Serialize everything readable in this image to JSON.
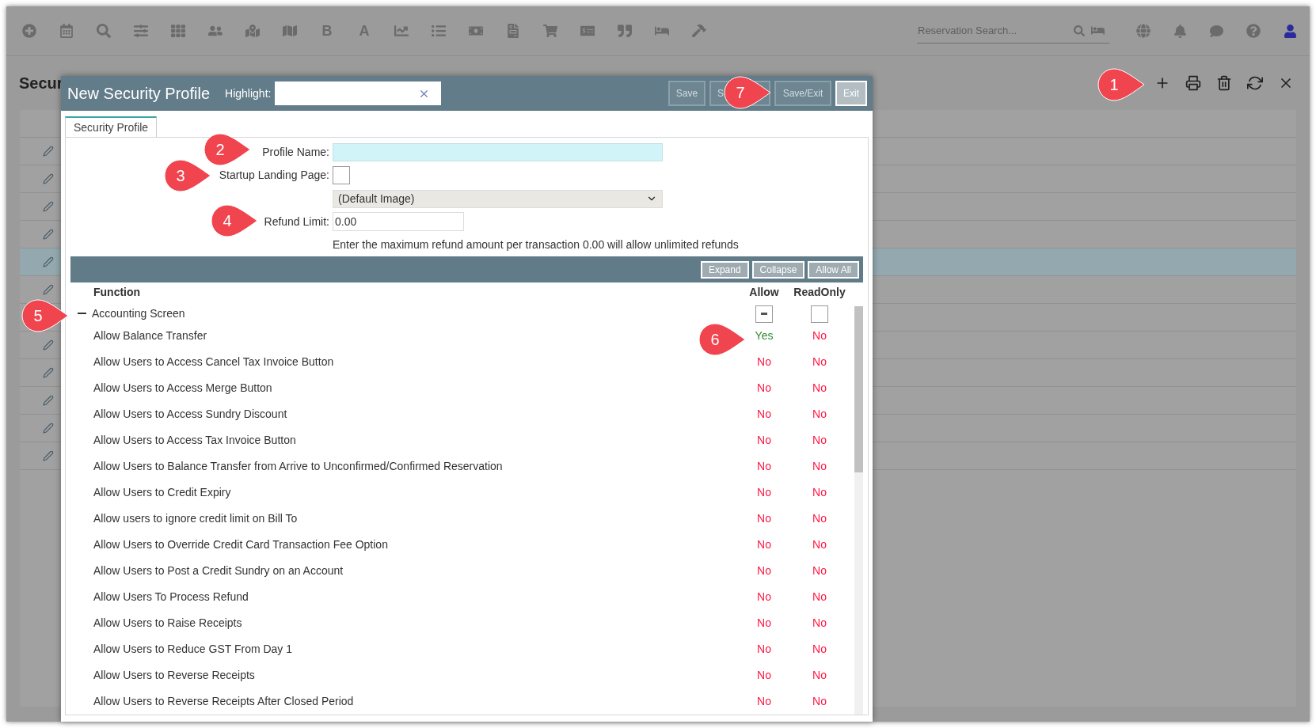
{
  "top_bar": {
    "letters": [
      "B",
      "A"
    ],
    "search": {
      "placeholder": "Reservation Search..."
    }
  },
  "page": {
    "title": "Secur",
    "rows": [
      {
        "selected": false
      },
      {
        "selected": false
      },
      {
        "selected": false
      },
      {
        "selected": false
      },
      {
        "selected": true
      },
      {
        "selected": false
      },
      {
        "selected": false
      },
      {
        "selected": false
      },
      {
        "selected": false
      },
      {
        "selected": false
      },
      {
        "selected": false
      }
    ]
  },
  "dialog": {
    "title": "New Security Profile",
    "highlight_label": "Highlight:",
    "buttons": [
      {
        "label": "Save",
        "disabled": true
      },
      {
        "label": "S",
        "disabled": true
      },
      {
        "label": "Save/Exit",
        "disabled": true
      },
      {
        "label": "Exit",
        "disabled": false
      }
    ],
    "tab": {
      "label": "Security Profile",
      "selected": true
    },
    "form": {
      "profile_name_label": "Profile Name:",
      "startup_label": "Startup Landing Page:",
      "startup_checked": false,
      "image_select": "(Default Image)",
      "refund_label": "Refund Limit:",
      "refund_value": "0.00",
      "refund_hint": "Enter the maximum refund amount per transaction 0.00 will allow unlimited refunds"
    },
    "grid": {
      "buttons": [
        "Expand",
        "Collapse",
        "Allow All"
      ],
      "columns": [
        "Function",
        "Allow",
        "ReadOnly"
      ],
      "group": {
        "label": "Accounting Screen",
        "expanded": true,
        "allow_mixed": true,
        "readonly_checked": false
      },
      "rows": [
        {
          "label": "Allow Balance Transfer",
          "allow": {
            "text": "Yes",
            "yes": true
          },
          "readonly": {
            "text": "No",
            "yes": false
          }
        },
        {
          "label": "Allow Users to Access Cancel Tax Invoice Button",
          "allow": {
            "text": "No",
            "yes": false
          },
          "readonly": {
            "text": "No",
            "yes": false
          }
        },
        {
          "label": "Allow Users to Access Merge Button",
          "allow": {
            "text": "No",
            "yes": false
          },
          "readonly": {
            "text": "No",
            "yes": false
          }
        },
        {
          "label": "Allow Users to Access Sundry Discount",
          "allow": {
            "text": "No",
            "yes": false
          },
          "readonly": {
            "text": "No",
            "yes": false
          }
        },
        {
          "label": "Allow Users to Access Tax Invoice Button",
          "allow": {
            "text": "No",
            "yes": false
          },
          "readonly": {
            "text": "No",
            "yes": false
          }
        },
        {
          "label": "Allow Users to Balance Transfer from Arrive to Unconfirmed/Confirmed Reservation",
          "allow": {
            "text": "No",
            "yes": false
          },
          "readonly": {
            "text": "No",
            "yes": false
          }
        },
        {
          "label": "Allow Users to Credit Expiry",
          "allow": {
            "text": "No",
            "yes": false
          },
          "readonly": {
            "text": "No",
            "yes": false
          }
        },
        {
          "label": "Allow users to ignore credit limit on Bill To",
          "allow": {
            "text": "No",
            "yes": false
          },
          "readonly": {
            "text": "No",
            "yes": false
          }
        },
        {
          "label": "Allow Users to Override Credit Card Transaction Fee Option",
          "allow": {
            "text": "No",
            "yes": false
          },
          "readonly": {
            "text": "No",
            "yes": false
          }
        },
        {
          "label": "Allow Users to Post a Credit Sundry on an Account",
          "allow": {
            "text": "No",
            "yes": false
          },
          "readonly": {
            "text": "No",
            "yes": false
          }
        },
        {
          "label": "Allow Users To Process Refund",
          "allow": {
            "text": "No",
            "yes": false
          },
          "readonly": {
            "text": "No",
            "yes": false
          }
        },
        {
          "label": "Allow Users to Raise Receipts",
          "allow": {
            "text": "No",
            "yes": false
          },
          "readonly": {
            "text": "No",
            "yes": false
          }
        },
        {
          "label": "Allow Users to Reduce GST From Day 1",
          "allow": {
            "text": "No",
            "yes": false
          },
          "readonly": {
            "text": "No",
            "yes": false
          }
        },
        {
          "label": "Allow Users to Reverse Receipts",
          "allow": {
            "text": "No",
            "yes": false
          },
          "readonly": {
            "text": "No",
            "yes": false
          }
        },
        {
          "label": "Allow Users to Reverse Receipts After Closed Period",
          "allow": {
            "text": "No",
            "yes": false
          },
          "readonly": {
            "text": "No",
            "yes": false
          }
        }
      ]
    }
  },
  "callouts": [
    {
      "number": "1"
    },
    {
      "number": "2"
    },
    {
      "number": "3"
    },
    {
      "number": "4"
    },
    {
      "number": "5"
    },
    {
      "number": "6"
    },
    {
      "number": "7"
    }
  ]
}
